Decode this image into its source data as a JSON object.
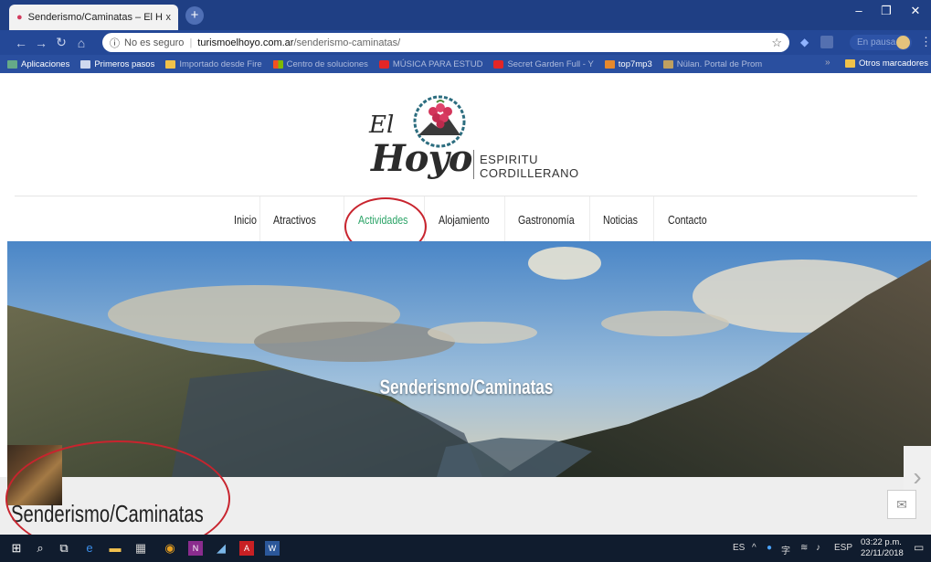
{
  "browser": {
    "tab_title": "Senderismo/Caminatas – El Hoyo",
    "tab_close": "x",
    "new_tab": "+",
    "security": "No es seguro",
    "url_domain": "turismoelhoyo.com.ar",
    "url_path": "/senderismo-caminatas/",
    "profile_status": "En pausa",
    "window_controls": [
      "–",
      "❐",
      "✕"
    ]
  },
  "bookmarks": {
    "items": [
      {
        "label": "Aplicaciones",
        "icon": "apps-grid-icon"
      },
      {
        "label": "Primeros pasos",
        "icon": "page-icon"
      },
      {
        "label": "Importado desde Fire",
        "icon": "folder-icon"
      },
      {
        "label": "Centro de soluciones",
        "icon": "windows-logo-icon"
      },
      {
        "label": "MÚSICA PARA ESTUD",
        "icon": "youtube-icon"
      },
      {
        "label": "Secret Garden Full - Y",
        "icon": "youtube-icon"
      },
      {
        "label": "top7mp3",
        "icon": "download-icon"
      },
      {
        "label": "Nülan. Portal de Prom",
        "icon": "nulan-icon"
      }
    ],
    "overflow": "»",
    "other": "Otros marcadores"
  },
  "site": {
    "logo": {
      "el": "El",
      "hoyo": "Hoyo",
      "line1": "ESPIRITU",
      "line2": "CORDILLERANO"
    },
    "nav": [
      "Inicio",
      "Atractivos",
      "Actividades",
      "Alojamiento",
      "Gastronomía",
      "Noticias",
      "Contacto"
    ],
    "active_nav": "Actividades",
    "hero_title": "Senderismo/Caminatas",
    "page_title": "Senderismo/Caminatas",
    "colors": {
      "active": "#2aa366",
      "annotation": "#c8242e"
    }
  },
  "taskbar": {
    "lang": "ES",
    "keyboard": "ESP",
    "time": "03:22 p.m.",
    "date": "22/11/2018"
  }
}
